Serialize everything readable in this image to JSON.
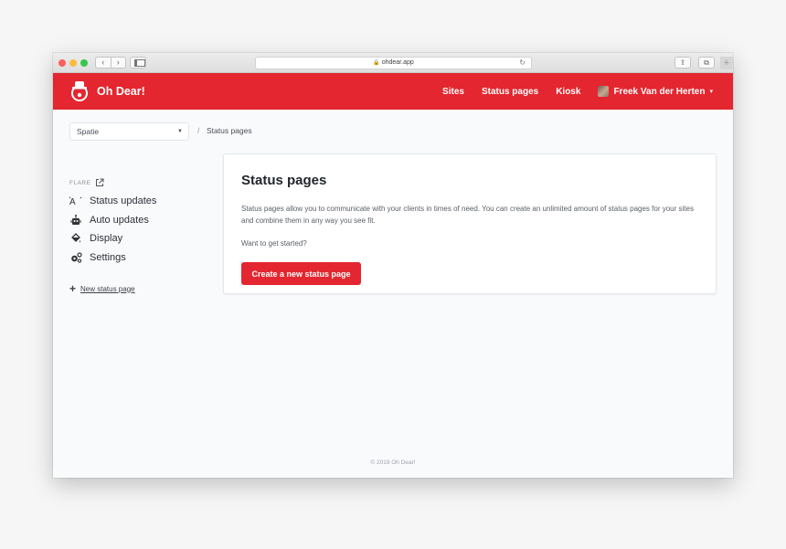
{
  "browser": {
    "url": "ohdear.app",
    "back_glyph": "‹",
    "forward_glyph": "›",
    "share_glyph": "⇪",
    "tabs_glyph": "⧉",
    "new_tab_glyph": "+",
    "lock_glyph": "🔒",
    "reload_glyph": "↻"
  },
  "header": {
    "brand": "Oh Dear!",
    "nav": [
      "Sites",
      "Status pages",
      "Kiosk"
    ],
    "user_name": "Freek Van der Herten",
    "caret_glyph": "▾",
    "brand_color": "#e3262f"
  },
  "breadcrumb": {
    "team": "Spatie",
    "separator": "/",
    "current": "Status pages"
  },
  "sidebar": {
    "section_title": "FLARE",
    "items": [
      {
        "label": "Status updates",
        "icon": "megaphone-icon"
      },
      {
        "label": "Auto updates",
        "icon": "robot-icon"
      },
      {
        "label": "Display",
        "icon": "paint-bucket-icon"
      },
      {
        "label": "Settings",
        "icon": "gears-icon"
      }
    ],
    "new_link_plus": "+",
    "new_link_label": "New status page"
  },
  "main": {
    "title": "Status pages",
    "description": "Status pages allow you to communicate with your clients in times of need. You can create an unlimited amount of status pages for your sites and combine them in any way you see fit.",
    "cta_text": "Want to get started?",
    "button_label": "Create a new status page"
  },
  "footer": {
    "text": "© 2019 Oh Dear!"
  }
}
